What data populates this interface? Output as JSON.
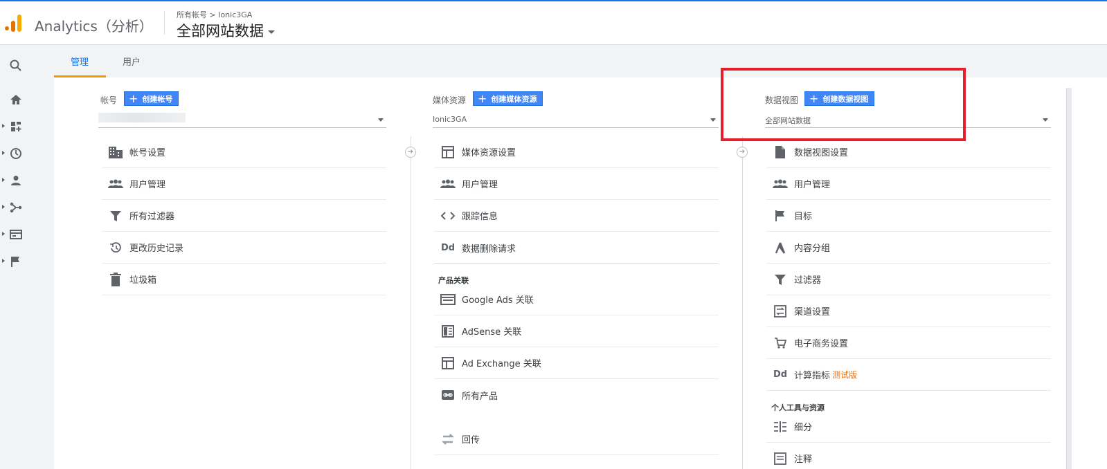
{
  "header": {
    "app_title": "Analytics（分析）",
    "breadcrumb": "所有帐号 > Ionic3GA",
    "view_title": "全部网站数据"
  },
  "left_nav": {
    "icons": [
      "search-icon",
      "home-icon",
      "dashboard-icon",
      "clock-icon",
      "person-icon",
      "acquisition-icon",
      "behavior-icon",
      "flag-icon"
    ]
  },
  "tabs": [
    {
      "label": "管理",
      "active": true
    },
    {
      "label": "用户",
      "active": false
    }
  ],
  "account": {
    "label": "帐号",
    "create_label": "创建帐号",
    "items": [
      {
        "label": "帐号设置",
        "icon": "building-icon"
      },
      {
        "label": "用户管理",
        "icon": "users-icon"
      },
      {
        "label": "所有过滤器",
        "icon": "filter-icon"
      },
      {
        "label": "更改历史记录",
        "icon": "history-icon"
      },
      {
        "label": "垃圾箱",
        "icon": "trash-icon"
      }
    ]
  },
  "property": {
    "label": "媒体资源",
    "create_label": "创建媒体资源",
    "selected": "Ionic3GA",
    "items": [
      {
        "label": "媒体资源设置",
        "icon": "layout-icon"
      },
      {
        "label": "用户管理",
        "icon": "users-icon"
      },
      {
        "label": "跟踪信息",
        "icon": "code-icon"
      },
      {
        "label": "数据删除请求",
        "icon": "dd-icon"
      }
    ],
    "product_section": "产品关联",
    "product_items": [
      {
        "label": "Google Ads 关联",
        "icon": "ads-icon"
      },
      {
        "label": "AdSense 关联",
        "icon": "adsense-icon"
      },
      {
        "label": "Ad Exchange 关联",
        "icon": "adexchange-icon"
      },
      {
        "label": "所有产品",
        "icon": "link-icon"
      }
    ],
    "extra_items": [
      {
        "label": "回传",
        "icon": "postback-icon"
      }
    ]
  },
  "view": {
    "label": "数据视图",
    "create_label": "创建数据视图",
    "selected": "全部网站数据",
    "items": [
      {
        "label": "数据视图设置",
        "icon": "document-icon"
      },
      {
        "label": "用户管理",
        "icon": "users-icon"
      },
      {
        "label": "目标",
        "icon": "flag-icon"
      },
      {
        "label": "内容分组",
        "icon": "grouping-icon"
      },
      {
        "label": "过滤器",
        "icon": "filter-icon"
      },
      {
        "label": "渠道设置",
        "icon": "channel-icon"
      },
      {
        "label": "电子商务设置",
        "icon": "cart-icon"
      },
      {
        "label": "计算指标",
        "beta": "测试版",
        "icon": "dd-icon"
      }
    ],
    "personal_section": "个人工具与资源",
    "personal_items": [
      {
        "label": "细分",
        "icon": "segments-icon"
      },
      {
        "label": "注释",
        "icon": "annotation-icon"
      }
    ]
  },
  "colors": {
    "accent": "#1a73e8",
    "button": "#4285f4",
    "tab_underline": "#f29900",
    "highlight": "#e5202e",
    "beta": "#e8710a"
  }
}
